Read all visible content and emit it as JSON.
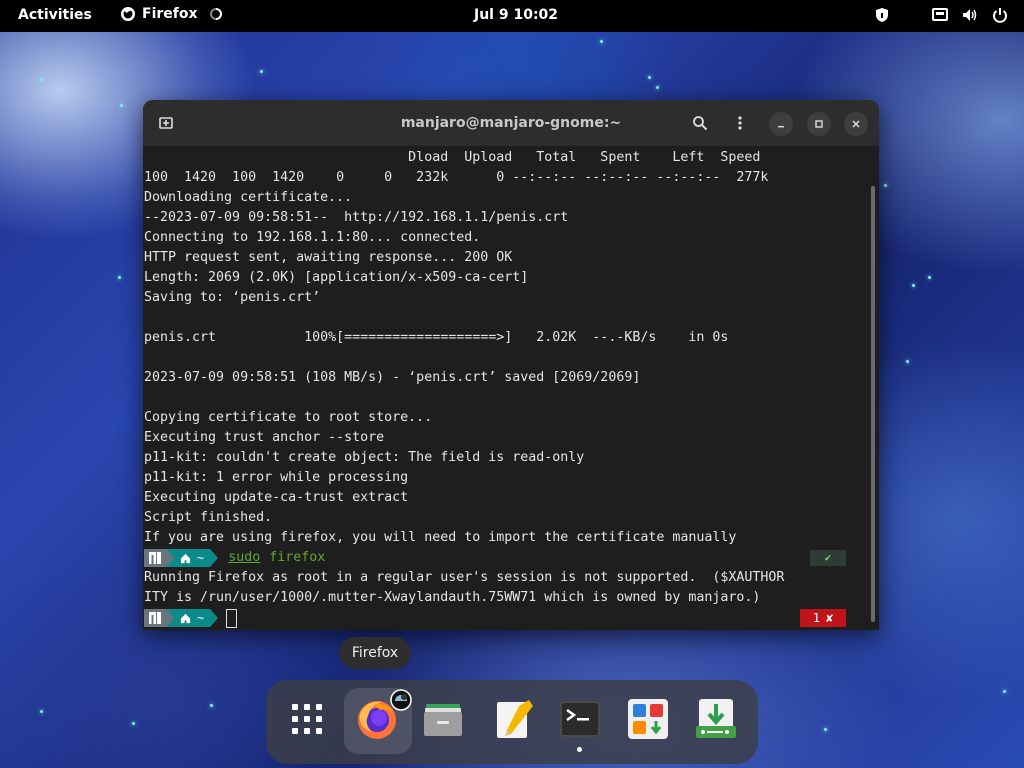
{
  "topbar": {
    "activities": "Activities",
    "app_name": "Firefox",
    "clock": "Jul 9  10:02"
  },
  "terminal": {
    "title": "manjaro@manjaro-gnome:~",
    "lines": [
      "                                 Dload  Upload   Total   Spent    Left  Speed",
      "100  1420  100  1420    0     0   232k      0 --:--:-- --:--:-- --:--:--  277k",
      "Downloading certificate...",
      "--2023-07-09 09:58:51--  http://192.168.1.1/penis.crt",
      "Connecting to 192.168.1.1:80... connected.",
      "HTTP request sent, awaiting response... 200 OK",
      "Length: 2069 (2.0K) [application/x-x509-ca-cert]",
      "Saving to: ‘penis.crt’",
      "",
      "penis.crt           100%[===================>]   2.02K  --.-KB/s    in 0s",
      "",
      "2023-07-09 09:58:51 (108 MB/s) - ‘penis.crt’ saved [2069/2069]",
      "",
      "Copying certificate to root store...",
      "Executing trust anchor --store",
      "p11-kit: couldn't create object: The field is read-only",
      "p11-kit: 1 error while processing",
      "Executing update-ca-trust extract",
      "Script finished.",
      "If you are using firefox, you will need to import the certificate manually"
    ],
    "prompt_home": "~",
    "command_sudo": "sudo",
    "command_arg": "firefox",
    "ok_mark": "✔",
    "output_lines": [
      "Running Firefox as root in a regular user's session is not supported.  ($XAUTHOR",
      "ITY is /run/user/1000/.mutter-Xwaylandauth.75WW71 which is owned by manjaro.)"
    ],
    "error_code": "1",
    "error_mark": "✘"
  },
  "tooltip": "Firefox",
  "dock": {
    "items": [
      "app-grid-icon",
      "firefox-icon",
      "files-icon",
      "text-editor-icon",
      "terminal-icon",
      "software-icon",
      "downloader-icon"
    ]
  },
  "colors": {
    "prompt_teal": "#0b8a8a",
    "command_green": "#5fa82e",
    "error_red": "#c0141b"
  }
}
